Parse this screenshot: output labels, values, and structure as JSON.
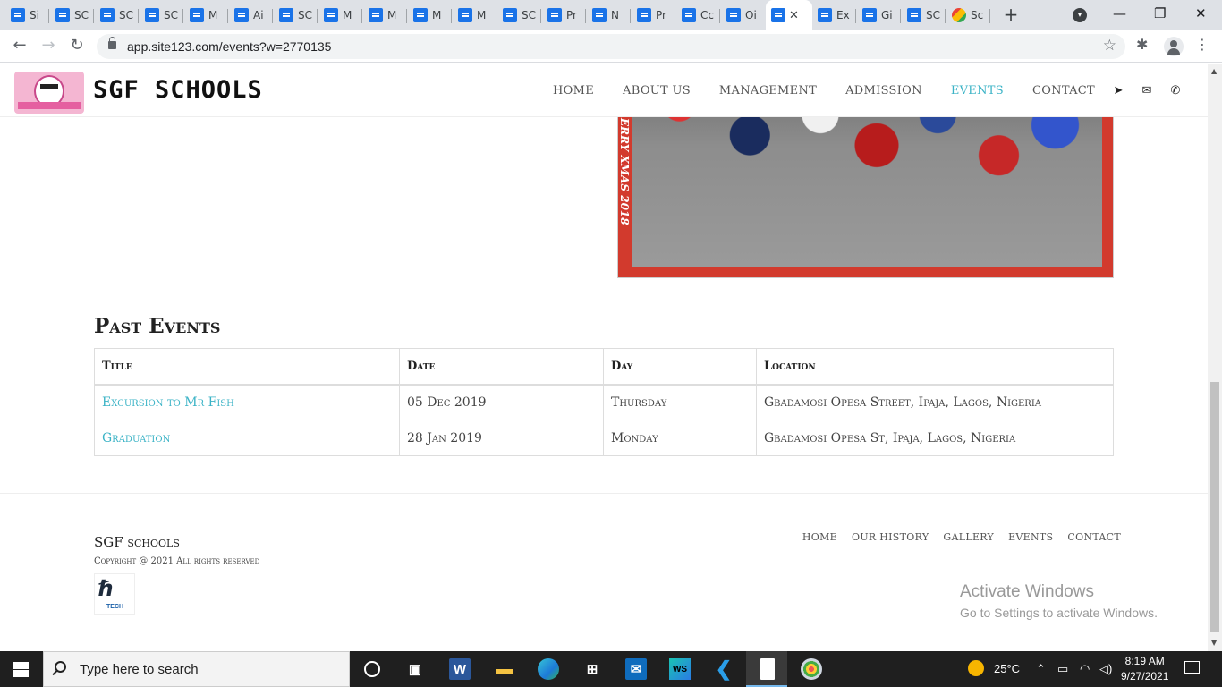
{
  "browser": {
    "tabs": [
      {
        "title": "Si",
        "icon": "docs-icon"
      },
      {
        "title": "SC",
        "icon": "docs-icon"
      },
      {
        "title": "SC",
        "icon": "docs-icon"
      },
      {
        "title": "SC",
        "icon": "docs-icon"
      },
      {
        "title": "M",
        "icon": "docs-icon"
      },
      {
        "title": "Ai",
        "icon": "docs-icon"
      },
      {
        "title": "SC",
        "icon": "docs-icon"
      },
      {
        "title": "M",
        "icon": "docs-icon"
      },
      {
        "title": "M",
        "icon": "docs-icon"
      },
      {
        "title": "M",
        "icon": "docs-icon"
      },
      {
        "title": "M",
        "icon": "docs-icon"
      },
      {
        "title": "SC",
        "icon": "docs-icon"
      },
      {
        "title": "Pr",
        "icon": "docs-icon"
      },
      {
        "title": "N",
        "icon": "docs-icon"
      },
      {
        "title": "Pr",
        "icon": "docs-icon"
      },
      {
        "title": "Cc",
        "icon": "docs-icon"
      },
      {
        "title": "Oi",
        "icon": "docs-icon"
      },
      {
        "title": "",
        "icon": "docs-icon",
        "active": true
      },
      {
        "title": "Ex",
        "icon": "docs-icon"
      },
      {
        "title": "Gi",
        "icon": "docs-icon"
      },
      {
        "title": "SC",
        "icon": "docs-icon"
      },
      {
        "title": "Sc",
        "icon": "site-icon"
      }
    ],
    "url": "app.site123.com/events?w=2770135",
    "close_glyph": "✕",
    "new_tab_glyph": "+",
    "tab_search_glyph": "▾",
    "minimize_glyph": "—",
    "maximize_glyph": "❐",
    "window_close_glyph": "✕",
    "back_glyph": "←",
    "forward_glyph": "→",
    "reload_glyph": "↻",
    "star_glyph": "☆",
    "extensions_glyph": "✱",
    "menu_glyph": "⋮"
  },
  "site": {
    "brand": "SGF SCHOOLS",
    "nav": [
      "HOME",
      "ABOUT US",
      "MANAGEMENT",
      "ADMISSION",
      "EVENTS",
      "CONTACT"
    ],
    "active_nav": "EVENTS",
    "nav_icons": [
      "location-arrow-icon",
      "envelope-icon",
      "phone-icon"
    ],
    "nav_icon_glyphs": [
      "➤",
      "✉",
      "✆"
    ],
    "accent_color": "#3bb3c6",
    "photo_caption": "ERRY XMAS 2018"
  },
  "past_events": {
    "heading": "Past Events",
    "columns": [
      "Title",
      "Date",
      "Day",
      "Location"
    ],
    "rows": [
      {
        "title": "Excursion to Mr Fish",
        "date": "05 Dec 2019",
        "day": "Thursday",
        "location": "Gbadamosi Opesa Street, Ipaja, Lagos, Nigeria"
      },
      {
        "title": "Graduation",
        "date": "28 Jan 2019",
        "day": "Monday",
        "location": "Gbadamosi Opesa St, Ipaja, Lagos, Nigeria"
      }
    ]
  },
  "footer": {
    "brand": "SGF schools",
    "copyright": "Copyright @ 2021 All rights reserved",
    "logo_text": "TECH",
    "nav": [
      "HOME",
      "OUR HISTORY",
      "GALLERY",
      "EVENTS",
      "CONTACT"
    ]
  },
  "watermark": {
    "line1": "Activate Windows",
    "line2": "Go to Settings to activate Windows."
  },
  "taskbar": {
    "search_placeholder": "Type here to search",
    "apps": [
      "cortana-icon",
      "task-view-icon",
      "word-icon",
      "file-explorer-icon",
      "edge-icon",
      "store-icon",
      "mail-icon",
      "webstorm-icon",
      "vscode-icon",
      "notepad-icon",
      "paint-icon"
    ],
    "weather": "25°C",
    "time": "8:19 AM",
    "date": "9/27/2021"
  }
}
